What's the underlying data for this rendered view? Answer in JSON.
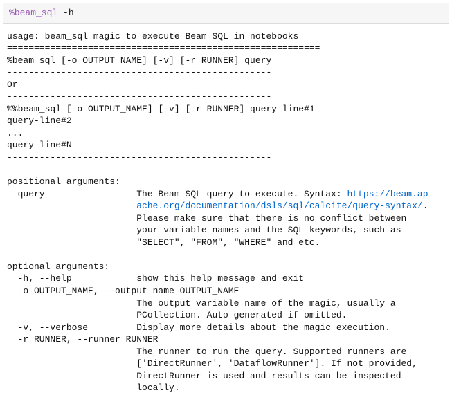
{
  "input": {
    "magic": "%beam_sql",
    "args": " -h"
  },
  "out": {
    "usage_line": "usage: beam_sql magic to execute Beam SQL in notebooks",
    "sep1": "==========================================================",
    "line_single": "%beam_sql [-o OUTPUT_NAME] [-v] [-r RUNNER] query",
    "sep2": "-------------------------------------------------",
    "or": "Or",
    "sep3": "-------------------------------------------------",
    "cell_l1": "%%beam_sql [-o OUTPUT_NAME] [-v] [-r RUNNER] query-line#1",
    "cell_l2": "query-line#2",
    "cell_l3": "...",
    "cell_l4": "query-line#N",
    "sep4": "-------------------------------------------------",
    "blank": "",
    "pos_hdr": "positional arguments:",
    "pos_q1": "  query                 The Beam SQL query to execute. Syntax: ",
    "pos_link1": "https://beam.ap",
    "pos_link2": "                        ache.org/documentation/dsls/sql/calcite/query-syntax/",
    "pos_link2_tail": ".",
    "pos_q3": "                        Please make sure that there is no conflict between",
    "pos_q4": "                        your variable names and the SQL keywords, such as",
    "pos_q5": "                        \"SELECT\", \"FROM\", \"WHERE\" and etc.",
    "opt_hdr": "optional arguments:",
    "opt_h": "  -h, --help            show this help message and exit",
    "opt_o1": "  -o OUTPUT_NAME, --output-name OUTPUT_NAME",
    "opt_o2": "                        The output variable name of the magic, usually a",
    "opt_o3": "                        PCollection. Auto-generated if omitted.",
    "opt_v": "  -v, --verbose         Display more details about the magic execution.",
    "opt_r1": "  -r RUNNER, --runner RUNNER",
    "opt_r2": "                        The runner to run the query. Supported runners are",
    "opt_r3": "                        ['DirectRunner', 'DataflowRunner']. If not provided,",
    "opt_r4": "                        DirectRunner is used and results can be inspected",
    "opt_r5": "                        locally."
  }
}
